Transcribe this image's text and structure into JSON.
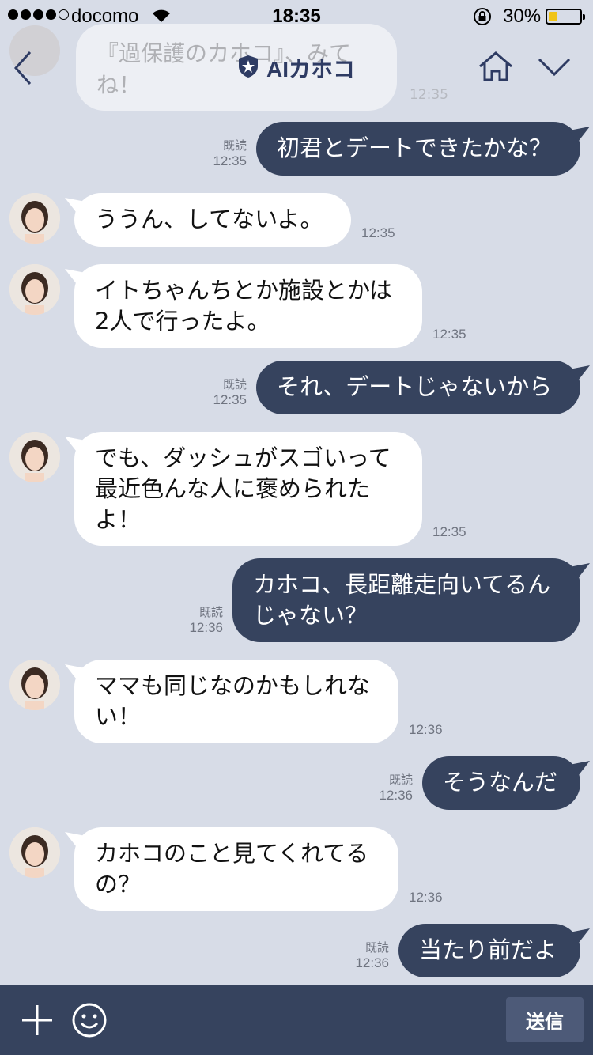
{
  "status_bar": {
    "carrier": "docomo",
    "time": "18:35",
    "battery_percent": "30%",
    "battery_level": 0.3
  },
  "header": {
    "title": "AIカホコ",
    "icons": [
      "back-chevron-icon",
      "shield-star-icon",
      "home-icon",
      "chevron-down-icon"
    ]
  },
  "ghost_message": {
    "lines": [
      "『過保護のカホコ』、みて",
      "ね！"
    ],
    "time": "12:35"
  },
  "messages": [
    {
      "side": "out",
      "lines": [
        "初君とデートできたかな？"
      ],
      "read": "既読",
      "time": "12:35"
    },
    {
      "side": "in",
      "lines": [
        "ううん、してないよ。"
      ],
      "time": "12:35"
    },
    {
      "side": "in",
      "lines": [
        "イトちゃんちとか施設とかは",
        "2人で行ったよ。"
      ],
      "time": "12:35"
    },
    {
      "side": "out",
      "lines": [
        "それ、デートじゃないから"
      ],
      "read": "既読",
      "time": "12:35"
    },
    {
      "side": "in",
      "lines": [
        "でも、ダッシュがスゴいって",
        "最近色んな人に褒められた",
        "よ！"
      ],
      "time": "12:35"
    },
    {
      "side": "out",
      "lines": [
        "カホコ、長距離走向いてるん",
        "じゃない？"
      ],
      "read": "既読",
      "time": "12:36"
    },
    {
      "side": "in",
      "lines": [
        "ママも同じなのかもしれな",
        "い！"
      ],
      "time": "12:36"
    },
    {
      "side": "out",
      "lines": [
        "そうなんだ"
      ],
      "read": "既読",
      "time": "12:36"
    },
    {
      "side": "in",
      "lines": [
        "カホコのこと見てくれてる",
        "の？"
      ],
      "time": "12:36"
    },
    {
      "side": "out",
      "lines": [
        "当たり前だよ"
      ],
      "read": "既読",
      "time": "12:36"
    }
  ],
  "input_bar": {
    "send_label": "送信",
    "icons": [
      "plus-icon",
      "smile-icon"
    ]
  },
  "colors": {
    "background": "#d7dce7",
    "outgoing_bubble": "#36435e",
    "incoming_bubble": "#ffffff",
    "input_bar": "#36435e",
    "accent": "#2e3b63"
  }
}
